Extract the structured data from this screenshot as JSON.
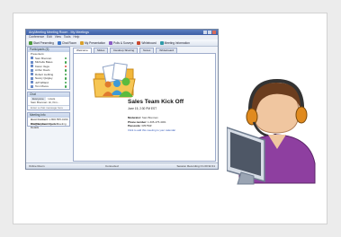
{
  "app": {
    "title": "AnyMeeting Meeting Room - My Meetings",
    "menu": [
      "Conference",
      "Edit",
      "View",
      "Tools",
      "Help"
    ],
    "toolbar": [
      "Start Presenting",
      "Chat Room",
      "My Presentation",
      "Polls & Surveys",
      "Whiteboard",
      "Meeting Information"
    ],
    "participants_header": "Participants (6)",
    "presenters_label": "Presenters:",
    "participant_names": [
      "Sam Brennan",
      "Michelle Bates",
      "Karen Vega",
      "Arthur Davis",
      "Robert Liebling",
      "Nancy Quigley",
      "Jeff Willard",
      "Tom Moore"
    ],
    "chat_header": "Chat",
    "chat_tabs": [
      "Everyone",
      "Hosts"
    ],
    "chat_line": "Sam Brennan: Hi, Kim...",
    "chat_placeholder": "Enter a chat message here",
    "info_header": "Meeting Info",
    "info_rows": [
      [
        "Host Contact:",
        "1.800.555.0199 info@anymeeting.com"
      ],
      [
        "Dial Number:",
        "Check Meeting Details"
      ]
    ],
    "tabs": [
      "Welcome",
      "Slides",
      "Desktop Sharing",
      "Notes",
      "Whiteboard"
    ],
    "meeting_title": "Sales Team Kick Off",
    "meeting_date": "June 15, 2:30 PM EST",
    "moderator_label": "Moderator:",
    "moderator": "Sam Brennan",
    "phone_label": "Phone number:",
    "phone": "1-605-475-4001",
    "passcode_label": "Passcode:",
    "passcode": "335784#",
    "link_text": "Click to add this meeting to your calendar",
    "status_left": "Online Room",
    "status_mid": "Connected",
    "status_right": "Session Recording On   00:32:41"
  },
  "colors": {
    "titlebar": "#3b5da6",
    "frame_bg": "#ececec",
    "headset": "#e08a1e"
  }
}
